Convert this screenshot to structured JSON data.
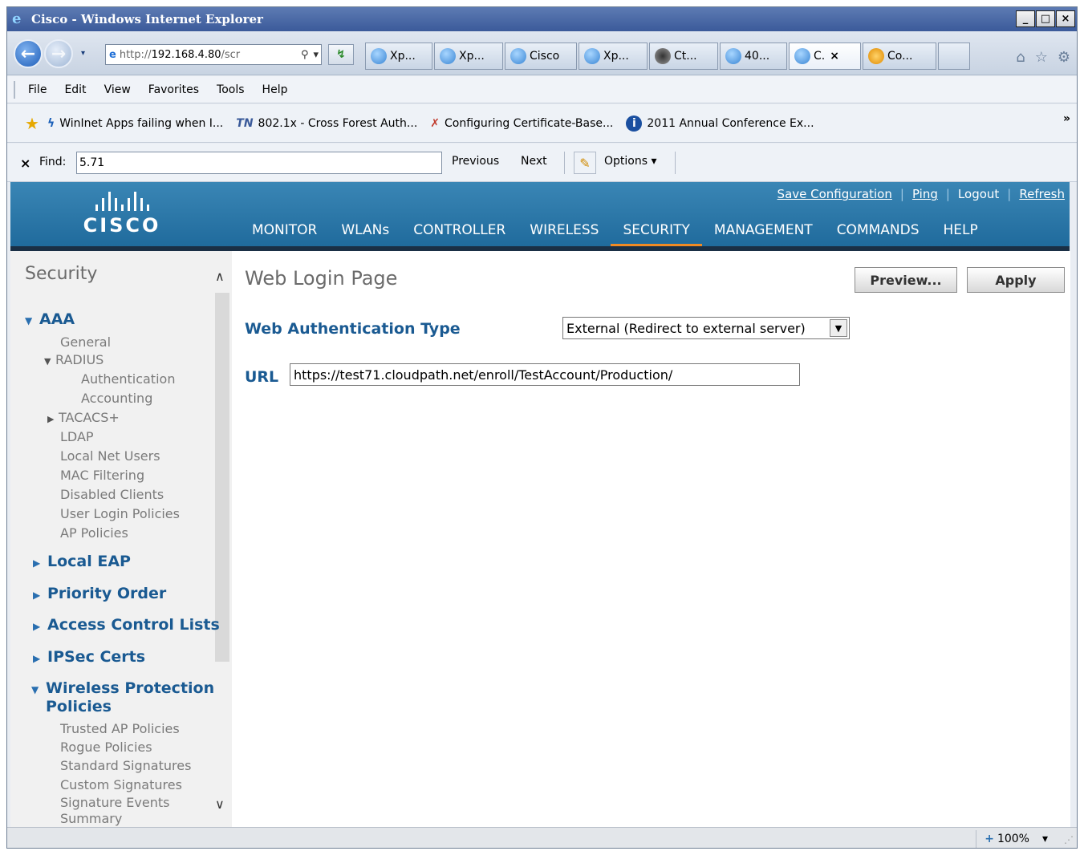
{
  "window": {
    "title": "Cisco - Windows Internet Explorer",
    "controls": [
      "_",
      "□",
      "×"
    ]
  },
  "nav": {
    "address": "http://192.168.4.80/scr",
    "address_host": "192.168.4.80",
    "address_prefix": "http://",
    "address_suffix": "/scr",
    "search_glyph": "⚲",
    "dropdown_glyph": "▾",
    "tabs": [
      {
        "label": "Xp..."
      },
      {
        "label": "Xp..."
      },
      {
        "label": "Cisco"
      },
      {
        "label": "Xp..."
      },
      {
        "label": "Ct..."
      },
      {
        "label": "40..."
      },
      {
        "label": "C.",
        "close": "×"
      },
      {
        "label": "Co..."
      }
    ]
  },
  "menubar": {
    "items": [
      "File",
      "Edit",
      "View",
      "Favorites",
      "Tools",
      "Help"
    ]
  },
  "favorites": {
    "items": [
      {
        "label": "WinInet Apps failing when I...",
        "icon": "ϟ",
        "color": "#1a5fb8"
      },
      {
        "label": "802.1x - Cross Forest Auth...",
        "icon": "TN",
        "color": "#3a5a9a"
      },
      {
        "label": "Configuring Certificate-Base...",
        "icon": "✗",
        "color": "#c0392b"
      },
      {
        "label": "2011 Annual Conference Ex...",
        "icon": "i",
        "color": "#1a4fa0"
      }
    ],
    "more": "»"
  },
  "findbar": {
    "close": "×",
    "label": "Find:",
    "value": "5.71",
    "previous": "Previous",
    "next": "Next",
    "options": "Options ▾"
  },
  "cisco": {
    "brand": "CISCO",
    "top_links": [
      "Save Configuration",
      "Ping",
      "Logout",
      "Refresh"
    ],
    "menu": [
      "MONITOR",
      "WLANs",
      "CONTROLLER",
      "WIRELESS",
      "SECURITY",
      "MANAGEMENT",
      "COMMANDS",
      "HELP"
    ],
    "active_menu": "SECURITY",
    "accent_color": "#f08a24",
    "header_color": "#2a78aa"
  },
  "sidebar": {
    "title": "Security",
    "items": [
      {
        "label": "AAA",
        "type": "section",
        "expanded": true
      },
      {
        "label": "General",
        "type": "sub"
      },
      {
        "label": "RADIUS",
        "type": "sub",
        "expanded": true
      },
      {
        "label": "Authentication",
        "type": "subsub"
      },
      {
        "label": "Accounting",
        "type": "subsub"
      },
      {
        "label": "TACACS+",
        "type": "sub",
        "expanded": false
      },
      {
        "label": "LDAP",
        "type": "sub"
      },
      {
        "label": "Local Net Users",
        "type": "sub"
      },
      {
        "label": "MAC Filtering",
        "type": "sub"
      },
      {
        "label": "Disabled Clients",
        "type": "sub"
      },
      {
        "label": "User Login Policies",
        "type": "sub"
      },
      {
        "label": "AP Policies",
        "type": "sub"
      },
      {
        "label": "Local EAP",
        "type": "section",
        "expanded": false
      },
      {
        "label": "Priority Order",
        "type": "section",
        "expanded": false
      },
      {
        "label": "Access Control Lists",
        "type": "section",
        "expanded": false
      },
      {
        "label": "IPSec Certs",
        "type": "section",
        "expanded": false
      },
      {
        "label": "Wireless Protection",
        "type": "section",
        "expanded": true
      },
      {
        "label": "Policies",
        "type": "section-cont"
      },
      {
        "label": "Trusted AP Policies",
        "type": "sub"
      },
      {
        "label": "Rogue Policies",
        "type": "sub"
      },
      {
        "label": "Standard Signatures",
        "type": "sub"
      },
      {
        "label": "Custom Signatures",
        "type": "sub"
      },
      {
        "label": "Signature Events",
        "type": "sub"
      },
      {
        "label": "Summary",
        "type": "sub"
      }
    ]
  },
  "content": {
    "page_title": "Web Login Page",
    "preview_label": "Preview...",
    "apply_label": "Apply",
    "auth_type_label": "Web Authentication Type",
    "auth_type_value": "External (Redirect to external server)",
    "url_label": "URL",
    "url_value": "https://test71.cloudpath.net/enroll/TestAccount/Production/"
  },
  "status": {
    "zoom": "100%",
    "zoom_dd": "▾"
  }
}
